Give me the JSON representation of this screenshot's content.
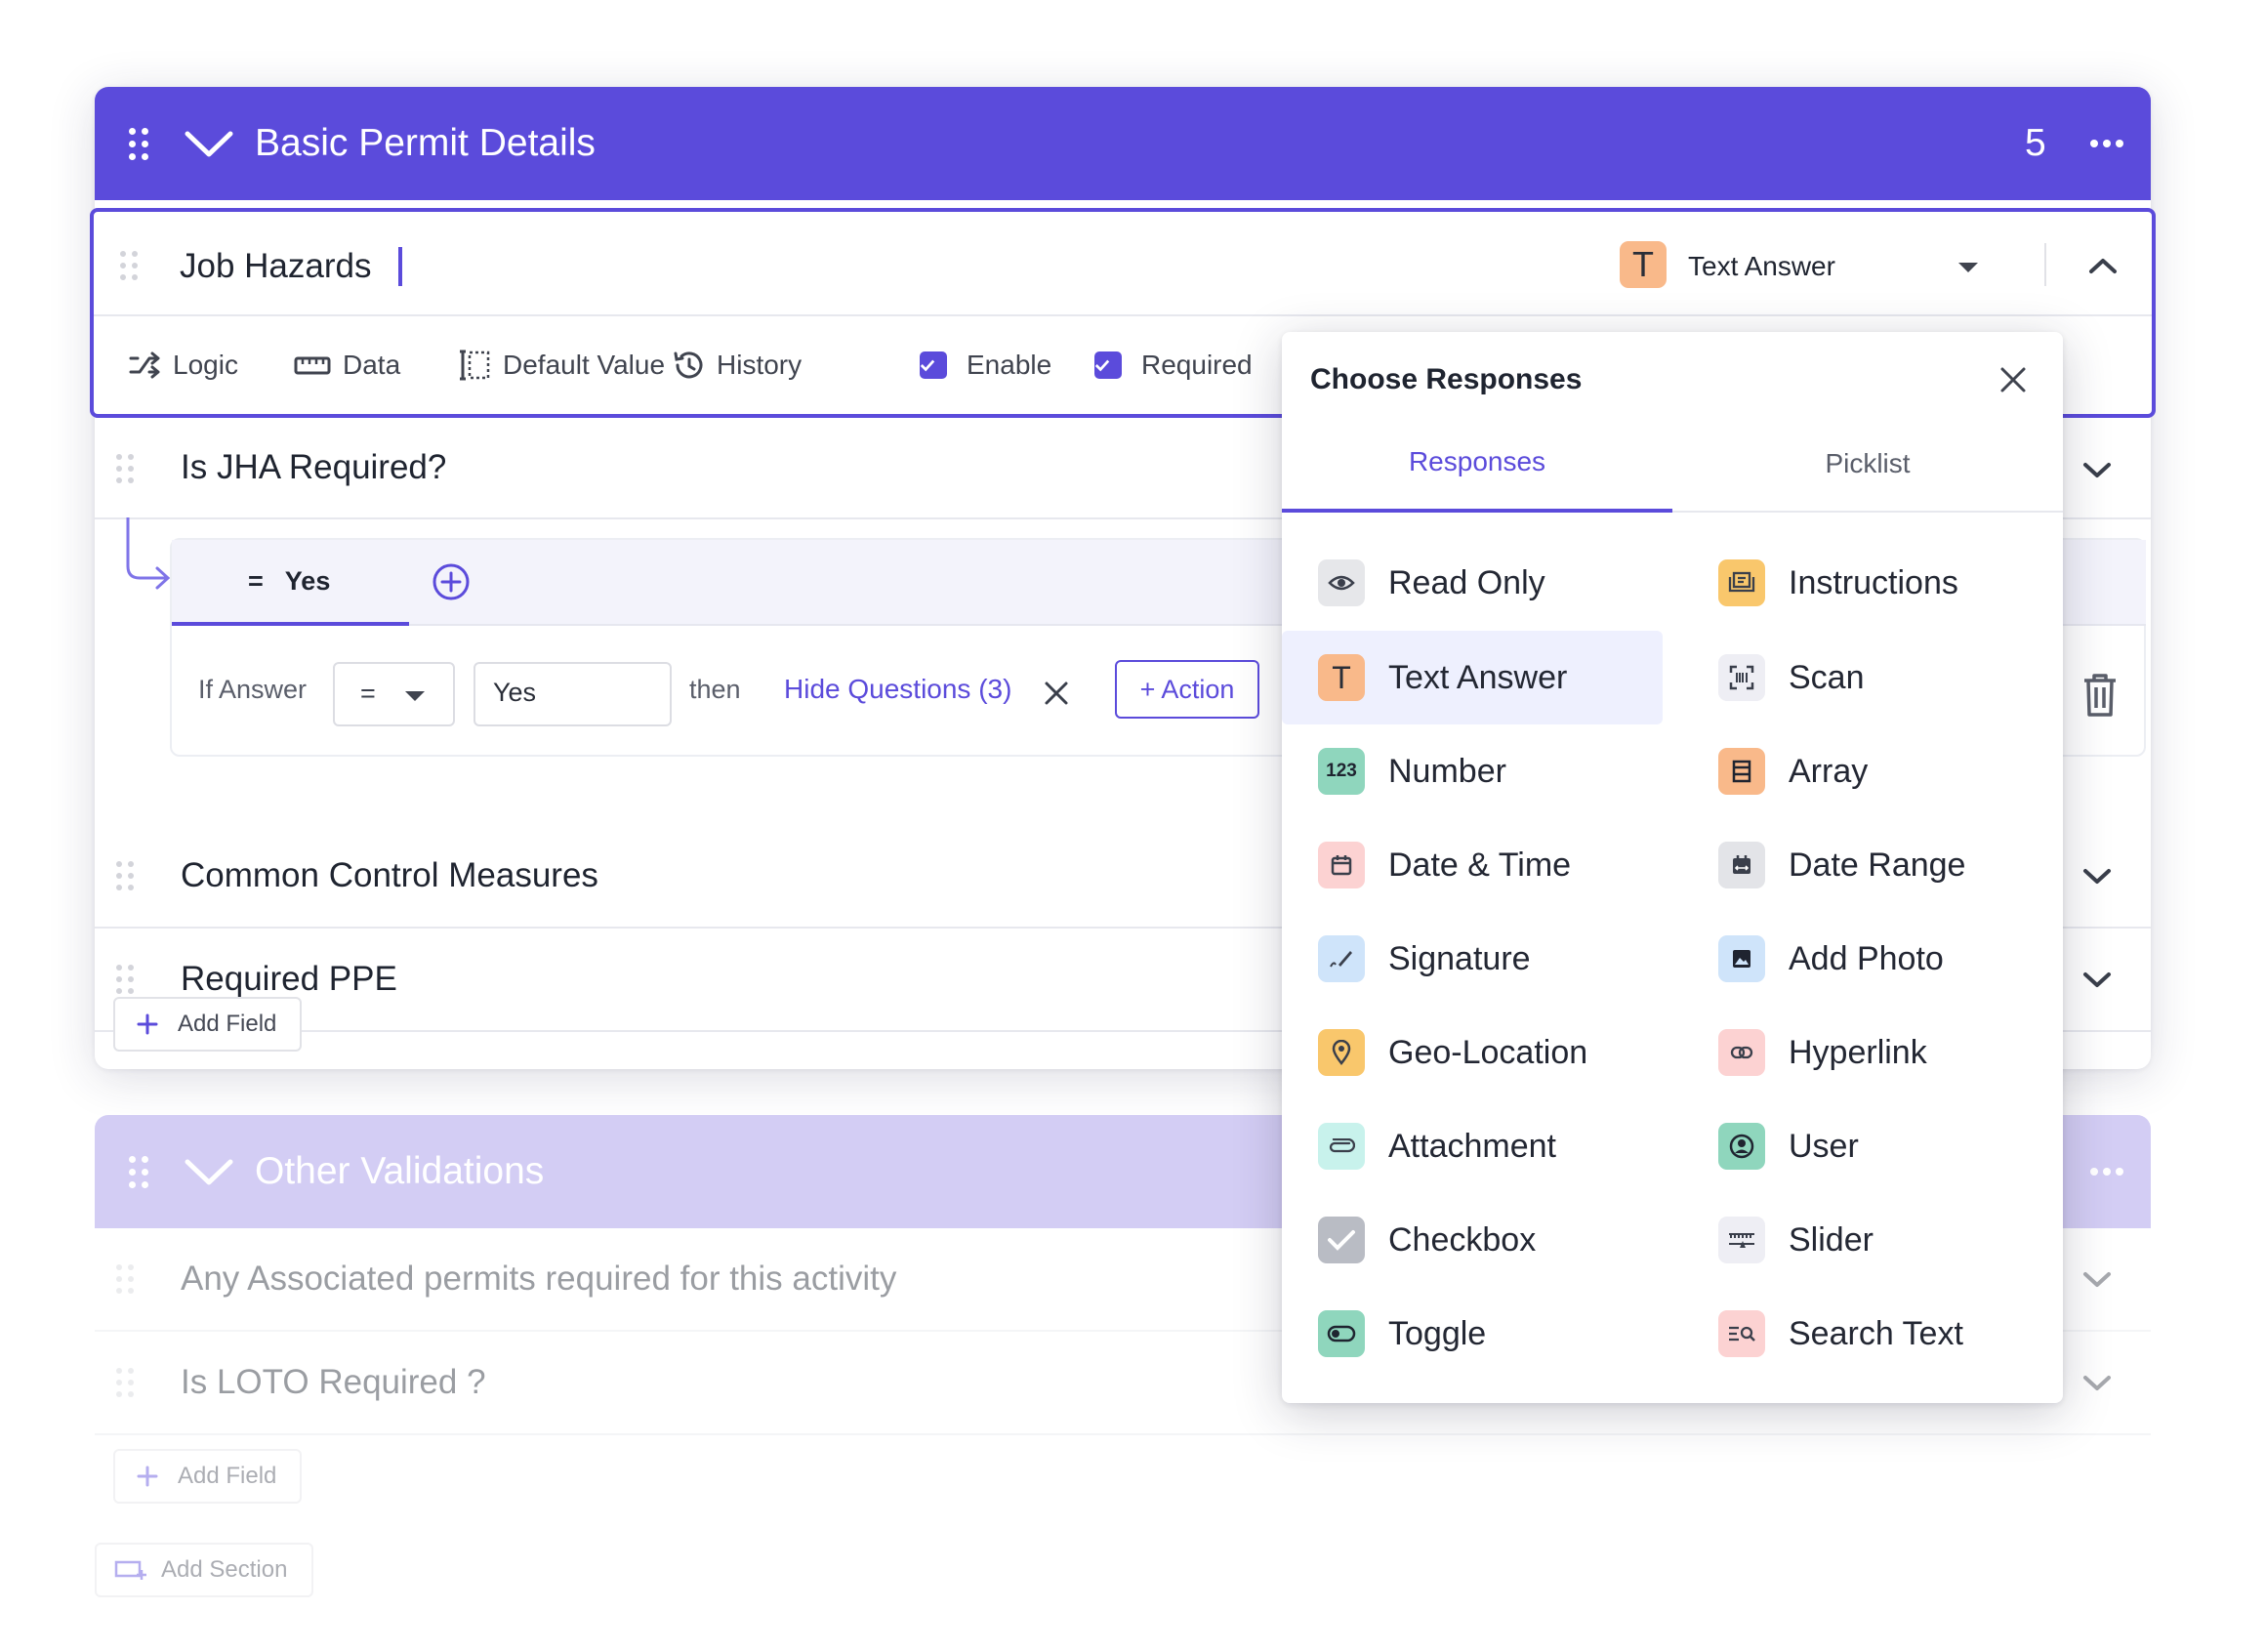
{
  "section1": {
    "title": "Basic Permit Details",
    "count": "5"
  },
  "active_field": {
    "title": "Job Hazards",
    "type_icon": "T",
    "type_label": "Text Answer"
  },
  "toolbar": {
    "logic": "Logic",
    "data": "Data",
    "default_value": "Default Value",
    "history": "History",
    "enable": "Enable",
    "required": "Required"
  },
  "fields": [
    {
      "label": "Is JHA Required?"
    },
    {
      "label": "Common Control Measures"
    },
    {
      "label": "Required PPE"
    }
  ],
  "logic": {
    "tab_prefix": "=",
    "tab_value": "Yes",
    "if_answer": "If Answer",
    "operator": "=",
    "value": "Yes",
    "then": "then",
    "action_text": "Hide Questions (3)",
    "add_action": "+ Action"
  },
  "add_field": "Add Field",
  "section2": {
    "title": "Other Validations",
    "fields": [
      {
        "label": "Any Associated permits required for this activity"
      },
      {
        "label": "Is LOTO Required ?"
      }
    ],
    "add_field": "Add Field"
  },
  "add_section": "Add Section",
  "popup": {
    "title": "Choose Responses",
    "tabs": [
      "Responses",
      "Picklist"
    ],
    "active_tab": "Responses",
    "left_options": [
      {
        "label": "Read Only",
        "icon": "eye-icon",
        "bg": "#e6e7ea"
      },
      {
        "label": "Text Answer",
        "icon": "text-t-icon",
        "bg": "#f9b98a",
        "selected": true
      },
      {
        "label": "Number",
        "icon": "number-123-icon",
        "bg": "#8fd6bd"
      },
      {
        "label": "Date & Time",
        "icon": "calendar-icon",
        "bg": "#fcd2d2"
      },
      {
        "label": "Signature",
        "icon": "pen-icon",
        "bg": "#cfe4fa"
      },
      {
        "label": "Geo-Location",
        "icon": "map-pin-icon",
        "bg": "#f9c76c"
      },
      {
        "label": "Attachment",
        "icon": "paperclip-icon",
        "bg": "#c8f2ec"
      },
      {
        "label": "Checkbox",
        "icon": "checkbox-icon",
        "bg": "#b9bcc4"
      },
      {
        "label": "Toggle",
        "icon": "toggle-icon",
        "bg": "#8fd6bd"
      }
    ],
    "right_options": [
      {
        "label": "Instructions",
        "icon": "book-icon",
        "bg": "#f9c76c"
      },
      {
        "label": "Scan",
        "icon": "scan-icon",
        "bg": "#eeeef4"
      },
      {
        "label": "Array",
        "icon": "array-icon",
        "bg": "#f9b98a"
      },
      {
        "label": "Date Range",
        "icon": "date-range-icon",
        "bg": "#e3e4e8"
      },
      {
        "label": "Add Photo",
        "icon": "photo-icon",
        "bg": "#cfe4fa"
      },
      {
        "label": "Hyperlink",
        "icon": "link-icon",
        "bg": "#fcd2d2"
      },
      {
        "label": "User",
        "icon": "user-icon",
        "bg": "#8fd6bd"
      },
      {
        "label": "Slider",
        "icon": "slider-icon",
        "bg": "#eeeef4"
      },
      {
        "label": "Search Text",
        "icon": "search-text-icon",
        "bg": "#fcd2d2"
      }
    ]
  },
  "colors": {
    "accent": "#5b4bdb",
    "accent_light": "#d3cdf4",
    "selected_option_bg": "#eef0fe"
  }
}
